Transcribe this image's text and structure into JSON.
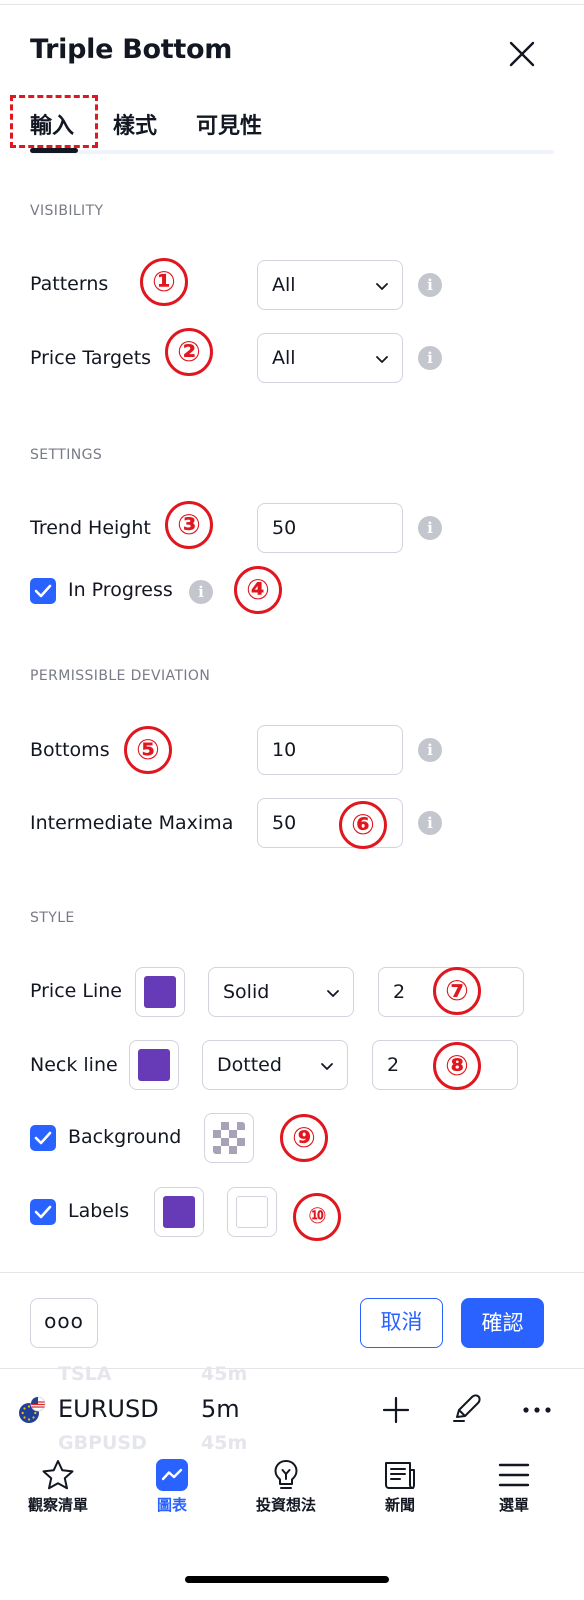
{
  "dialog": {
    "title": "Triple Bottom",
    "tabs": [
      "輸入",
      "樣式",
      "可見性"
    ],
    "active_tab": "輸入"
  },
  "sections": {
    "visibility": "VISIBILITY",
    "settings": "SETTINGS",
    "deviation": "PERMISSIBLE DEVIATION",
    "style": "STYLE"
  },
  "visibility": {
    "patterns_label": "Patterns",
    "patterns_value": "All",
    "price_targets_label": "Price Targets",
    "price_targets_value": "All"
  },
  "settings": {
    "trend_height_label": "Trend Height",
    "trend_height_value": "50",
    "in_progress_label": "In Progress",
    "in_progress_checked": true
  },
  "deviation": {
    "bottoms_label": "Bottoms",
    "bottoms_value": "10",
    "intermediate_label": "Intermediate Maxima",
    "intermediate_value": "50"
  },
  "style": {
    "price_line_label": "Price Line",
    "price_line_color": "#673ab7",
    "price_line_style": "Solid",
    "price_line_width": "2",
    "neck_line_label": "Neck line",
    "neck_line_color": "#673ab7",
    "neck_line_style": "Dotted",
    "neck_line_width": "2",
    "background_label": "Background",
    "background_checked": true,
    "labels_label": "Labels",
    "labels_checked": true,
    "labels_color": "#673ab7",
    "labels_text_color": "#ffffff"
  },
  "annotations": [
    "①",
    "②",
    "③",
    "④",
    "⑤",
    "⑥",
    "⑦",
    "⑧",
    "⑨",
    "⑩"
  ],
  "annotation_color": "#e0171f",
  "footer": {
    "more_label": "ooo",
    "cancel_label": "取消",
    "ok_label": "確認"
  },
  "symbol_bar": {
    "ghost_above_symbol": "TSLA",
    "ghost_above_interval": "45m",
    "symbol": "EURUSD",
    "interval": "5m",
    "ghost_below_symbol": "GBPUSD",
    "ghost_below_interval": "45m",
    "icons": [
      "plus-icon",
      "pen-icon",
      "more-icon"
    ]
  },
  "nav": {
    "items": [
      "觀察清單",
      "圖表",
      "投資想法",
      "新聞",
      "選單"
    ],
    "active": "圖表"
  },
  "colors": {
    "accent": "#2962ff",
    "text": "#131722",
    "muted": "#787b86",
    "border": "#d1d4dc"
  }
}
